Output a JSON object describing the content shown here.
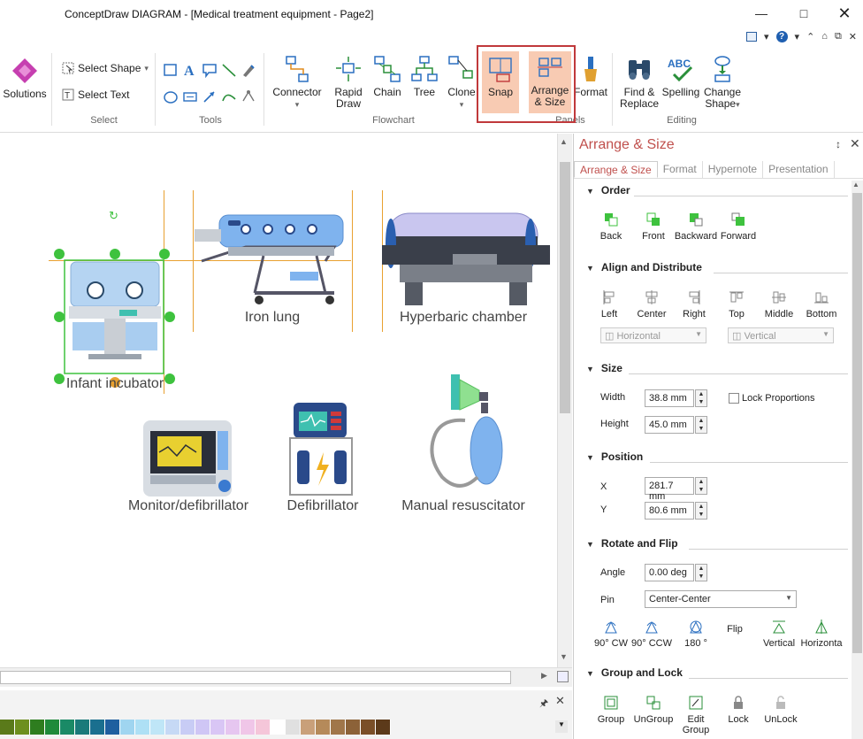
{
  "window": {
    "title": "ConceptDraw DIAGRAM - [Medical treatment equipment - Page2]"
  },
  "ribbon": {
    "solutions": "Solutions",
    "select_shape": "Select Shape",
    "select_text": "Select Text",
    "group_select": "Select",
    "group_tools": "Tools",
    "connector": "Connector",
    "rapid_draw_1": "Rapid",
    "rapid_draw_2": "Draw",
    "chain": "Chain",
    "tree": "Tree",
    "clone": "Clone",
    "snap": "Snap",
    "arrange_1": "Arrange",
    "arrange_2": "& Size",
    "format": "Format",
    "group_flowchart": "Flowchart",
    "group_panels": "Panels",
    "find_1": "Find &",
    "find_2": "Replace",
    "spelling": "Spelling",
    "change_1": "Change",
    "change_2": "Shape",
    "group_editing": "Editing"
  },
  "canvas": {
    "shapes": [
      {
        "label": "Infant incubator"
      },
      {
        "label": "Iron lung"
      },
      {
        "label": "Hyperbaric chamber"
      },
      {
        "label": "Monitor/defibrillator"
      },
      {
        "label": "Defibrillator"
      },
      {
        "label": "Manual resuscitator"
      }
    ]
  },
  "panel": {
    "title": "Arrange & Size",
    "tabs": [
      "Arrange & Size",
      "Format",
      "Hypernote",
      "Presentation"
    ],
    "order": {
      "title": "Order",
      "buttons": [
        "Back",
        "Front",
        "Backward",
        "Forward"
      ]
    },
    "align": {
      "title": "Align and Distribute",
      "buttons": [
        "Left",
        "Center",
        "Right",
        "Top",
        "Middle",
        "Bottom"
      ],
      "horizontal": "Horizontal",
      "vertical": "Vertical"
    },
    "size": {
      "title": "Size",
      "width_label": "Width",
      "width": "38.8 mm",
      "height_label": "Height",
      "height": "45.0 mm",
      "lock": "Lock Proportions"
    },
    "position": {
      "title": "Position",
      "x_label": "X",
      "x": "281.7 mm",
      "y_label": "Y",
      "y": "80.6 mm"
    },
    "rotate": {
      "title": "Rotate and Flip",
      "angle_label": "Angle",
      "angle": "0.00 deg",
      "pin_label": "Pin",
      "pin": "Center-Center",
      "buttons": [
        "90° CW",
        "90° CCW",
        "180 °",
        "Flip",
        "Vertical",
        "Horizonta"
      ]
    },
    "group": {
      "title": "Group and Lock",
      "buttons": [
        "Group",
        "UnGroup",
        "Edit Group",
        "Lock",
        "UnLock"
      ]
    }
  },
  "palette_colors": [
    "#5a7a1a",
    "#6d8f1e",
    "#2e7d1f",
    "#1f8a3a",
    "#1a8a66",
    "#1a7a7a",
    "#1a6f8f",
    "#1f5f9f",
    "#9fd5f0",
    "#aee0f5",
    "#bfe6f7",
    "#c6d9f5",
    "#c8ccf5",
    "#cfc6f5",
    "#d9c6f5",
    "#e6c6f0",
    "#f0c6e8",
    "#f5c6d9",
    "#ffffff",
    "#e0e0e0",
    "#c9a07a",
    "#b58a5a",
    "#a0764a",
    "#8c6238",
    "#7a4f28",
    "#5c3a1a"
  ]
}
